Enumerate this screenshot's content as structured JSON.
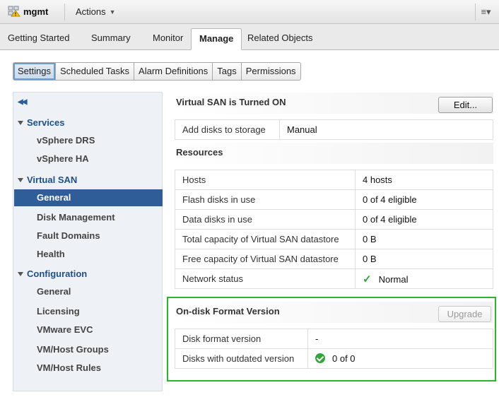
{
  "header": {
    "object_name": "mgmt",
    "actions_label": "Actions",
    "object_icon": "cluster-warning-icon",
    "menu_icon": "list-menu-icon"
  },
  "main_tabs": [
    "Getting Started",
    "Summary",
    "Monitor",
    "Manage",
    "Related Objects"
  ],
  "active_main_tab": "Manage",
  "sub_tabs": [
    "Settings",
    "Scheduled Tasks",
    "Alarm Definitions",
    "Tags",
    "Permissions"
  ],
  "active_sub_tab": "Settings",
  "sidebar": {
    "collapse_glyph": "◀◀",
    "groups": [
      {
        "label": "Services",
        "items": [
          "vSphere DRS",
          "vSphere HA"
        ]
      },
      {
        "label": "Virtual SAN",
        "items": [
          "General",
          "Disk Management",
          "Fault Domains",
          "Health"
        ]
      },
      {
        "label": "Configuration",
        "items": [
          "General",
          "Licensing",
          "VMware EVC",
          "VM/Host Groups",
          "VM/Host Rules"
        ]
      }
    ],
    "selected_item": "General"
  },
  "vsan": {
    "title": "Virtual SAN is Turned ON",
    "edit_label": "Edit...",
    "add_disks_label": "Add disks to storage",
    "add_disks_value": "Manual"
  },
  "resources": {
    "title": "Resources",
    "rows": [
      {
        "label": "Hosts",
        "value": "4 hosts"
      },
      {
        "label": "Flash disks in use",
        "value": "0 of 4 eligible"
      },
      {
        "label": "Data disks in use",
        "value": "0 of 4 eligible"
      },
      {
        "label": "Total capacity of Virtual SAN datastore",
        "value": "0 B"
      },
      {
        "label": "Free capacity of Virtual SAN datastore",
        "value": "0 B"
      },
      {
        "label": "Network status",
        "value": "Normal"
      }
    ]
  },
  "ondisk": {
    "title": "On-disk Format Version",
    "upgrade_label": "Upgrade",
    "format_label": "Disk format version",
    "format_value": "-",
    "outdated_label": "Disks with outdated version",
    "outdated_value": "0 of 0"
  },
  "colors": {
    "accent_selected": "#2e5d98",
    "highlight": "#2bb52b",
    "ok_green": "#35a03c"
  }
}
